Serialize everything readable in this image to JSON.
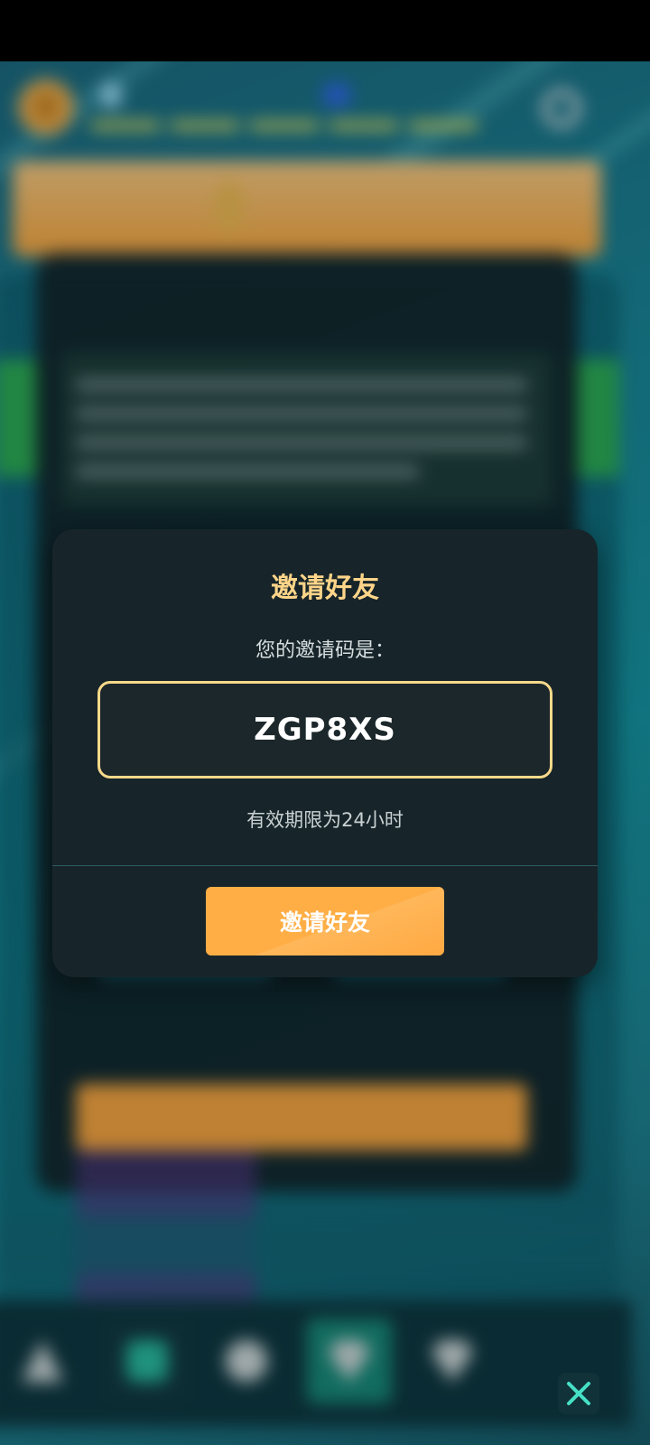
{
  "modal": {
    "title": "邀请好友",
    "subtitle": "您的邀请码是：",
    "invite_code": "ZGP8XS",
    "validity_text": "有效期限为24小时",
    "invite_button_label": "邀请好友"
  },
  "colors": {
    "modal_bg": "#17252a",
    "title": "#ffd589",
    "code_border": "#f7d98a",
    "button": "#ffae45"
  },
  "icons": {
    "close": "close-icon"
  }
}
